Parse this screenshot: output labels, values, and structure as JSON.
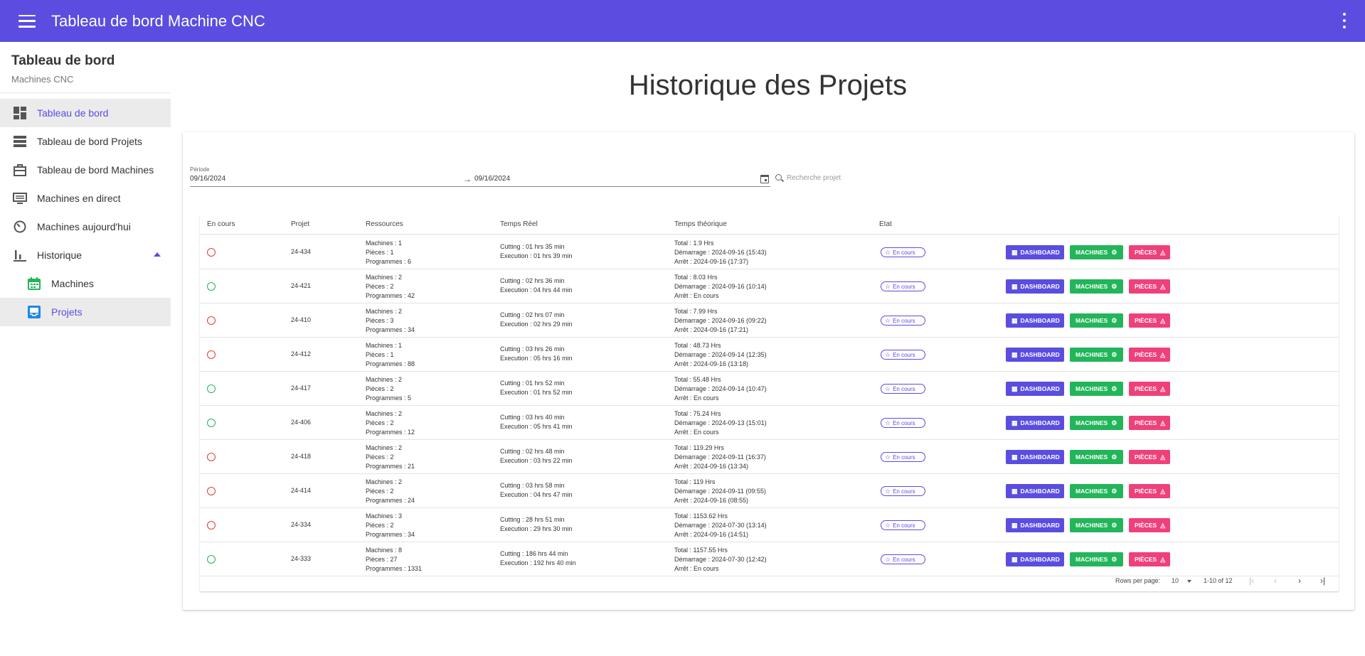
{
  "appbar": {
    "title": "Tableau de bord Machine CNC"
  },
  "sidebar": {
    "title": "Tableau de bord",
    "subtitle": "Machines CNC",
    "items": [
      {
        "label": "Tableau de bord",
        "icon": "dashboard-icon"
      },
      {
        "label": "Tableau de bord Projets",
        "icon": "list-icon"
      },
      {
        "label": "Tableau de bord Machines",
        "icon": "briefcase-icon"
      },
      {
        "label": "Machines en direct",
        "icon": "monitor-icon"
      },
      {
        "label": "Machines aujourd'hui",
        "icon": "timer-icon"
      },
      {
        "label": "Historique",
        "icon": "bar-chart-icon"
      },
      {
        "label": "Machines",
        "icon": "calendar-icon"
      },
      {
        "label": "Projets",
        "icon": "inbox-icon"
      }
    ]
  },
  "page": {
    "title": "Historique des Projets"
  },
  "filters": {
    "period_label": "Période",
    "date_from": "09/16/2024",
    "date_to": "09/16/2024",
    "search_placeholder": "Recherche projet"
  },
  "table": {
    "headers": [
      "En cours",
      "Projet",
      "Ressources",
      "Temps Réel",
      "Temps théorique",
      "Etat"
    ],
    "buttons": {
      "dashboard": "DASHBOARD",
      "machines": "MACHINES",
      "pieces": "PIÈCES"
    },
    "etat_label": "En cours",
    "rows": [
      {
        "status": "red",
        "projet": "24-434",
        "machines": "Machines : 1",
        "pieces": "Pièces : 1",
        "programmes": "Programmes : 6",
        "cutting": "Cutting : 01 hrs 35 min",
        "execution": "Execution : 01 hrs 39 min",
        "total": "Total : 1.9 Hrs",
        "demarrage": "Démarrage : 2024-09-16 (15:43)",
        "arret": "Arrêt : 2024-09-16 (17:37)"
      },
      {
        "status": "green",
        "projet": "24-421",
        "machines": "Machines : 2",
        "pieces": "Pièces : 2",
        "programmes": "Programmes : 42",
        "cutting": "Cutting : 02 hrs 36 min",
        "execution": "Execution : 04 hrs 44 min",
        "total": "Total : 8.03 Hrs",
        "demarrage": "Démarrage : 2024-09-16 (10:14)",
        "arret": "Arrêt : En cours"
      },
      {
        "status": "red",
        "projet": "24-410",
        "machines": "Machines : 2",
        "pieces": "Pièces : 3",
        "programmes": "Programmes : 34",
        "cutting": "Cutting : 02 hrs 07 min",
        "execution": "Execution : 02 hrs 29 min",
        "total": "Total : 7.99 Hrs",
        "demarrage": "Démarrage : 2024-09-16 (09:22)",
        "arret": "Arrêt : 2024-09-16 (17:21)"
      },
      {
        "status": "red",
        "projet": "24-412",
        "machines": "Machines : 1",
        "pieces": "Pièces : 1",
        "programmes": "Programmes : 88",
        "cutting": "Cutting : 03 hrs 26 min",
        "execution": "Execution : 05 hrs 16 min",
        "total": "Total : 48.73 Hrs",
        "demarrage": "Démarrage : 2024-09-14 (12:35)",
        "arret": "Arrêt : 2024-09-16 (13:18)"
      },
      {
        "status": "green",
        "projet": "24-417",
        "machines": "Machines : 2",
        "pieces": "Pièces : 2",
        "programmes": "Programmes : 5",
        "cutting": "Cutting : 01 hrs 52 min",
        "execution": "Execution : 01 hrs 52 min",
        "total": "Total : 55.48 Hrs",
        "demarrage": "Démarrage : 2024-09-14 (10:47)",
        "arret": "Arrêt : En cours"
      },
      {
        "status": "green",
        "projet": "24-406",
        "machines": "Machines : 2",
        "pieces": "Pièces : 2",
        "programmes": "Programmes : 12",
        "cutting": "Cutting : 03 hrs 40 min",
        "execution": "Execution : 05 hrs 41 min",
        "total": "Total : 75.24 Hrs",
        "demarrage": "Démarrage : 2024-09-13 (15:01)",
        "arret": "Arrêt : En cours"
      },
      {
        "status": "red",
        "projet": "24-418",
        "machines": "Machines : 2",
        "pieces": "Pièces : 2",
        "programmes": "Programmes : 21",
        "cutting": "Cutting : 02 hrs 48 min",
        "execution": "Execution : 03 hrs 22 min",
        "total": "Total : 119.29 Hrs",
        "demarrage": "Démarrage : 2024-09-11 (16:37)",
        "arret": "Arrêt : 2024-09-16 (13:34)"
      },
      {
        "status": "red",
        "projet": "24-414",
        "machines": "Machines : 2",
        "pieces": "Pièces : 2",
        "programmes": "Programmes : 24",
        "cutting": "Cutting : 03 hrs 58 min",
        "execution": "Execution : 04 hrs 47 min",
        "total": "Total : 119 Hrs",
        "demarrage": "Démarrage : 2024-09-11 (09:55)",
        "arret": "Arrêt : 2024-09-16 (08:55)"
      },
      {
        "status": "red",
        "projet": "24-334",
        "machines": "Machines : 3",
        "pieces": "Pièces : 2",
        "programmes": "Programmes : 34",
        "cutting": "Cutting : 28 hrs 51 min",
        "execution": "Execution : 29 hrs 30 min",
        "total": "Total : 1153.62 Hrs",
        "demarrage": "Démarrage : 2024-07-30 (13:14)",
        "arret": "Arrêt : 2024-09-16 (14:51)"
      },
      {
        "status": "green",
        "projet": "24-333",
        "machines": "Machines : 8",
        "pieces": "Pièces : 27",
        "programmes": "Programmes : 1331",
        "cutting": "Cutting : 186 hrs 44 min",
        "execution": "Execution : 192 hrs 40 min",
        "total": "Total : 1157.55 Hrs",
        "demarrage": "Démarrage : 2024-07-30 (12:42)",
        "arret": "Arrêt : En cours"
      }
    ]
  },
  "pagination": {
    "rows_per_page_label": "Rows per page:",
    "rows_per_page": "10",
    "range": "1-10 of 12"
  },
  "colors": {
    "primary": "#5a4de0",
    "success": "#22b55a",
    "danger": "#e53935",
    "pink": "#f0407a"
  }
}
